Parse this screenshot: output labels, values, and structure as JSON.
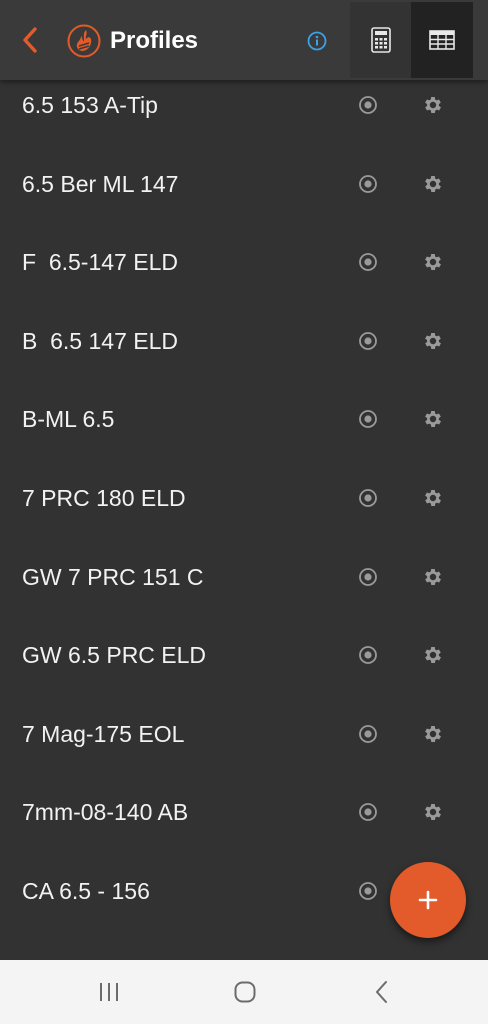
{
  "header": {
    "title": "Profiles",
    "back_icon": "chevron-left-icon",
    "logo_icon": "flame-logo-icon",
    "info_icon": "info-icon",
    "tabs": [
      {
        "name": "calculator",
        "icon": "calculator-icon",
        "selected": false
      },
      {
        "name": "table",
        "icon": "table-icon",
        "selected": true
      }
    ]
  },
  "profiles": [
    {
      "label": "6.5 153 A-Tip"
    },
    {
      "label": "6.5 Ber ML 147"
    },
    {
      "label": "F  6.5-147 ELD"
    },
    {
      "label": "B  6.5 147 ELD"
    },
    {
      "label": "B-ML 6.5"
    },
    {
      "label": "7 PRC 180 ELD"
    },
    {
      "label": "GW 7 PRC 151 C"
    },
    {
      "label": "GW 6.5 PRC ELD"
    },
    {
      "label": "7 Mag-175 EOL"
    },
    {
      "label": "7mm-08-140 AB"
    },
    {
      "label": "CA 6.5 - 156"
    }
  ],
  "row_icons": {
    "target": "target-icon",
    "settings": "gear-icon"
  },
  "fab": {
    "icon": "plus-icon"
  },
  "system_nav": {
    "recents": "recents-icon",
    "home": "home-icon",
    "back": "back-icon"
  },
  "colors": {
    "accent": "#e35b2a",
    "background": "#323232",
    "app_bar": "#3a3a3a",
    "info": "#3aa3e8",
    "text": "#f2f2f2",
    "icon": "#9a9a9a"
  }
}
